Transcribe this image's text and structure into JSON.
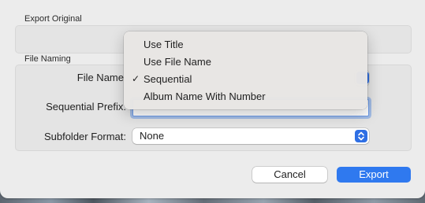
{
  "export_original": {
    "section_label": "Export Original"
  },
  "file_naming": {
    "section_label": "File Naming",
    "file_name_label": "File Name",
    "prefix_label": "Sequential Prefix:",
    "prefix_value": "",
    "subfolder_label": "Subfolder Format:",
    "subfolder_value": "None"
  },
  "menu": {
    "items": [
      {
        "label": "Use Title",
        "checked": false
      },
      {
        "label": "Use File Name",
        "checked": false
      },
      {
        "label": "Sequential",
        "checked": true
      },
      {
        "label": "Album Name With Number",
        "checked": false
      }
    ],
    "check_glyph": "✓"
  },
  "buttons": {
    "cancel": "Cancel",
    "export": "Export"
  },
  "colors": {
    "accent": "#2f79ef",
    "sheet": "#ececec",
    "menu": "#e8e5e3"
  }
}
